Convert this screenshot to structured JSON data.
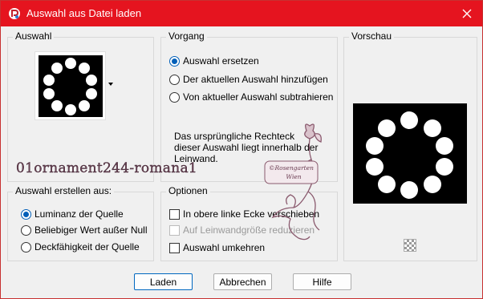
{
  "window": {
    "title": "Auswahl aus Datei laden"
  },
  "auswahl": {
    "label": "Auswahl"
  },
  "vorgang": {
    "label": "Vorgang",
    "options": [
      "Auswahl ersetzen",
      "Der aktuellen Auswahl hinzufügen",
      "Von aktueller Auswahl subtrahieren"
    ],
    "selected": "Auswahl ersetzen",
    "info": "Das ursprüngliche Rechteck dieser Auswahl liegt innerhalb der Leinwand."
  },
  "vorschau": {
    "label": "Vorschau"
  },
  "erstellen": {
    "label": "Auswahl erstellen aus:",
    "options": [
      "Luminanz der Quelle",
      "Beliebiger Wert außer Null",
      "Deckfähigkeit der Quelle"
    ],
    "selected": "Luminanz der Quelle"
  },
  "optionen": {
    "label": "Optionen",
    "items": [
      {
        "label": "In obere linke Ecke verschieben",
        "checked": false,
        "enabled": true
      },
      {
        "label": "Auf Leinwandgröße reduzieren",
        "checked": false,
        "enabled": false
      },
      {
        "label": "Auswahl umkehren",
        "checked": false,
        "enabled": true
      }
    ]
  },
  "overlay": {
    "watermark": "01ornament244-romana1",
    "stamp_line1": "©Rosengarten",
    "stamp_line2": "Wien"
  },
  "buttons": {
    "ok": "Laden",
    "cancel": "Abbrechen",
    "help": "Hilfe"
  },
  "colors": {
    "titlebar": "#e5141f",
    "accent": "#005fb8",
    "stamp": "#8a5a6e"
  }
}
